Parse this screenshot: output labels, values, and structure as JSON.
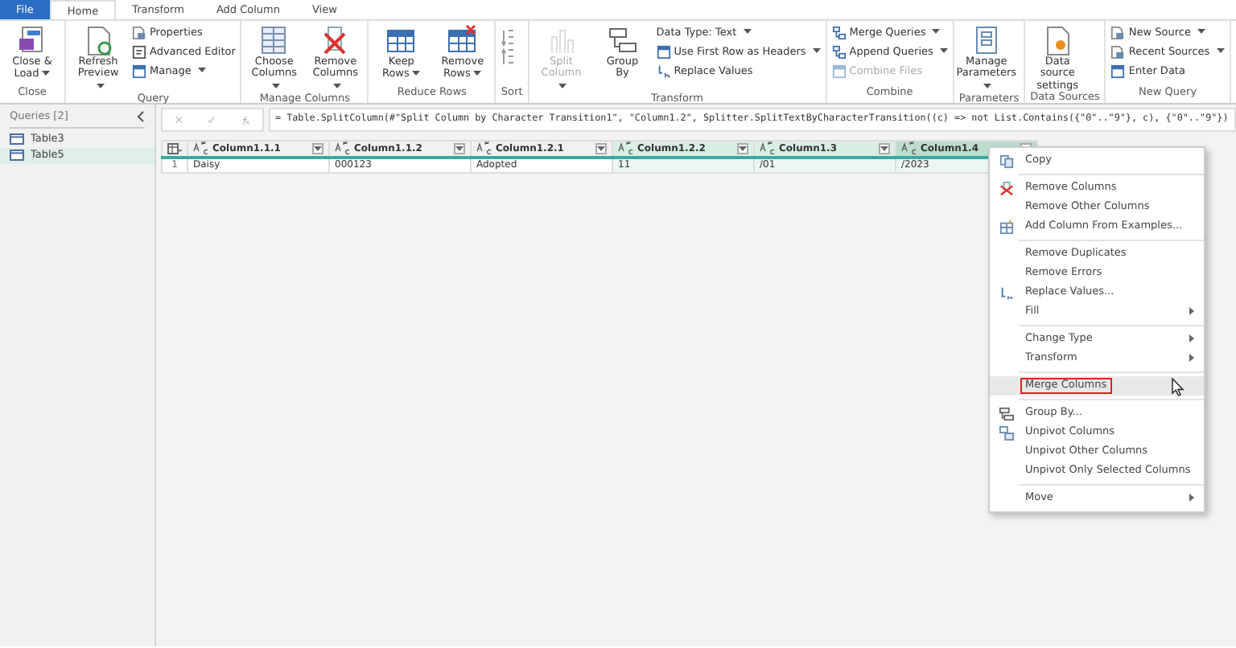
{
  "tabs": [
    {
      "label": "File",
      "kind": "file",
      "selected": false
    },
    {
      "label": "Home",
      "kind": "tab",
      "selected": true
    },
    {
      "label": "Transform",
      "kind": "tab",
      "selected": false
    },
    {
      "label": "Add Column",
      "kind": "tab",
      "selected": false
    },
    {
      "label": "View",
      "kind": "tab",
      "selected": false
    }
  ],
  "ribbon": {
    "groups": [
      {
        "label": "Close",
        "items": [
          {
            "kind": "large",
            "label": "Close & Load",
            "dropdown": true,
            "disabled": false
          }
        ]
      },
      {
        "label": "Query",
        "items": [
          {
            "kind": "large",
            "label": "Refresh Preview",
            "dropdown": true,
            "disabled": false
          },
          {
            "kind": "small",
            "label": "Properties",
            "dropdown": false,
            "disabled": false
          },
          {
            "kind": "small",
            "label": "Advanced Editor",
            "dropdown": false,
            "disabled": false
          },
          {
            "kind": "small",
            "label": "Manage",
            "dropdown": true,
            "disabled": false
          }
        ]
      },
      {
        "label": "Manage Columns",
        "items": [
          {
            "kind": "large",
            "label": "Choose Columns",
            "dropdown": true,
            "disabled": false
          },
          {
            "kind": "large",
            "label": "Remove Columns",
            "dropdown": true,
            "disabled": false
          }
        ]
      },
      {
        "label": "Reduce Rows",
        "items": [
          {
            "kind": "large",
            "label": "Keep Rows",
            "dropdown": true,
            "disabled": false
          },
          {
            "kind": "large",
            "label": "Remove Rows",
            "dropdown": true,
            "disabled": false
          }
        ]
      },
      {
        "label": "Sort",
        "items": [
          {
            "kind": "icons"
          }
        ]
      },
      {
        "label": "Transform",
        "items": [
          {
            "kind": "large",
            "label": "Split Column",
            "dropdown": true,
            "disabled": true
          },
          {
            "kind": "large",
            "label": "Group By",
            "dropdown": false,
            "disabled": false
          },
          {
            "kind": "small",
            "label": "Data Type: Text",
            "dropdown": true,
            "disabled": false
          },
          {
            "kind": "small",
            "label": "Use First Row as Headers",
            "dropdown": true,
            "disabled": false
          },
          {
            "kind": "small",
            "label": "Replace Values",
            "dropdown": false,
            "disabled": false
          }
        ]
      },
      {
        "label": "Combine",
        "items": [
          {
            "kind": "small",
            "label": "Merge Queries",
            "dropdown": true,
            "disabled": false
          },
          {
            "kind": "small",
            "label": "Append Queries",
            "dropdown": true,
            "disabled": false
          },
          {
            "kind": "small",
            "label": "Combine Files",
            "dropdown": false,
            "disabled": true
          }
        ]
      },
      {
        "label": "Parameters",
        "items": [
          {
            "kind": "large",
            "label": "Manage Parameters",
            "dropdown": true,
            "disabled": false
          }
        ]
      },
      {
        "label": "Data Sources",
        "items": [
          {
            "kind": "large",
            "label": "Data source settings",
            "dropdown": false,
            "disabled": false
          }
        ]
      },
      {
        "label": "New Query",
        "items": [
          {
            "kind": "small",
            "label": "New Source",
            "dropdown": true,
            "disabled": false
          },
          {
            "kind": "small",
            "label": "Recent Sources",
            "dropdown": true,
            "disabled": false
          },
          {
            "kind": "small",
            "label": "Enter Data",
            "dropdown": false,
            "disabled": false
          }
        ]
      }
    ]
  },
  "queries": {
    "title": "Queries [2]",
    "items": [
      {
        "label": "Table3",
        "selected": false
      },
      {
        "label": "Table5",
        "selected": true
      }
    ]
  },
  "formula": "= Table.SplitColumn(#\"Split Column by Character Transition1\", \"Column1.2\", Splitter.SplitTextByCharacterTransition((c) => not List.Contains({\"0\"..\"9\"}, c), {\"0\"..\"9\"})",
  "table": {
    "columns": [
      {
        "name": "Column1.1.1",
        "selected": false,
        "focused": false
      },
      {
        "name": "Column1.1.2",
        "selected": false,
        "focused": false
      },
      {
        "name": "Column1.2.1",
        "selected": false,
        "focused": false
      },
      {
        "name": "Column1.2.2",
        "selected": true,
        "focused": false
      },
      {
        "name": "Column1.3",
        "selected": true,
        "focused": false
      },
      {
        "name": "Column1.4",
        "selected": true,
        "focused": true
      }
    ],
    "rows": [
      {
        "number": "1",
        "cells": [
          "Daisy",
          "000123",
          "Adopted",
          "11",
          "/01",
          "/2023"
        ]
      }
    ]
  },
  "context_menu": {
    "sections": [
      [
        {
          "label": "Copy",
          "submenu": false,
          "hovered": false,
          "outlined": false
        }
      ],
      [
        {
          "label": "Remove Columns",
          "submenu": false,
          "hovered": false,
          "outlined": false
        },
        {
          "label": "Remove Other Columns",
          "submenu": false,
          "hovered": false,
          "outlined": false
        },
        {
          "label": "Add Column From Examples...",
          "submenu": false,
          "hovered": false,
          "outlined": false
        }
      ],
      [
        {
          "label": "Remove Duplicates",
          "submenu": false,
          "hovered": false,
          "outlined": false
        },
        {
          "label": "Remove Errors",
          "submenu": false,
          "hovered": false,
          "outlined": false
        },
        {
          "label": "Replace Values...",
          "submenu": false,
          "hovered": false,
          "outlined": false
        },
        {
          "label": "Fill",
          "submenu": true,
          "hovered": false,
          "outlined": false
        }
      ],
      [
        {
          "label": "Change Type",
          "submenu": true,
          "hovered": false,
          "outlined": false
        },
        {
          "label": "Transform",
          "submenu": true,
          "hovered": false,
          "outlined": false
        }
      ],
      [
        {
          "label": "Merge Columns",
          "submenu": false,
          "hovered": true,
          "outlined": true
        }
      ],
      [
        {
          "label": "Group By...",
          "submenu": false,
          "hovered": false,
          "outlined": false
        },
        {
          "label": "Unpivot Columns",
          "submenu": false,
          "hovered": false,
          "outlined": false
        },
        {
          "label": "Unpivot Other Columns",
          "submenu": false,
          "hovered": false,
          "outlined": false
        },
        {
          "label": "Unpivot Only Selected Columns",
          "submenu": false,
          "hovered": false,
          "outlined": false
        }
      ],
      [
        {
          "label": "Move",
          "submenu": true,
          "hovered": false,
          "outlined": false
        }
      ]
    ]
  }
}
